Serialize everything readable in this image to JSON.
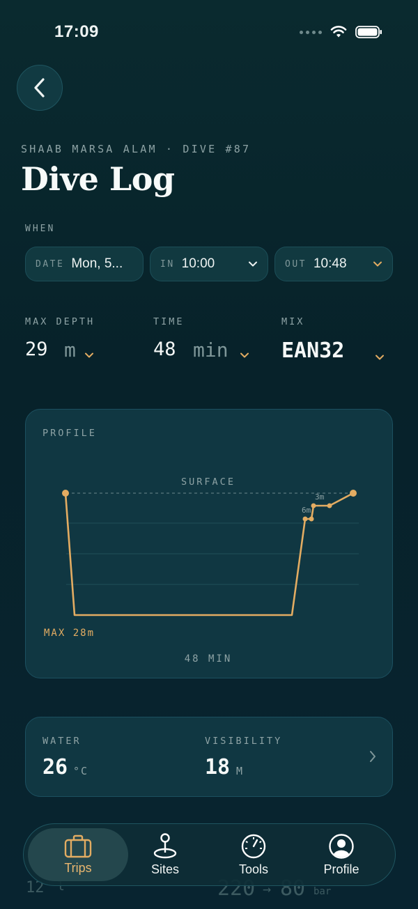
{
  "status_bar": {
    "time": "17:09"
  },
  "header": {
    "eyebrow": "SHAAB MARSA ALAM · DIVE #87",
    "title": "Dive Log"
  },
  "when": {
    "label": "WHEN",
    "date": {
      "label": "DATE",
      "value": "Mon, 5..."
    },
    "in": {
      "label": "IN",
      "value": "10:00"
    },
    "out": {
      "label": "OUT",
      "value": "10:48"
    }
  },
  "stats": {
    "max_depth": {
      "label": "MAX DEPTH",
      "value": "29",
      "unit": "m"
    },
    "time": {
      "label": "TIME",
      "value": "48",
      "unit": "min"
    },
    "mix": {
      "label": "MIX",
      "value": "EAN32"
    }
  },
  "profile": {
    "label": "PROFILE",
    "surface_label": "SURFACE",
    "max_label": "MAX 28m",
    "duration_label": "48 MIN",
    "stop_labels": [
      "6m",
      "3m"
    ],
    "color": "#e3ac62"
  },
  "conditions": {
    "water": {
      "label": "WATER",
      "value": "26",
      "unit": "°C"
    },
    "visibility": {
      "label": "VISIBILITY",
      "value": "18",
      "unit": "M"
    }
  },
  "behind_row": {
    "left": "12",
    "left_unit": "l",
    "pressure_start": "220",
    "pressure_end": "80",
    "pressure_unit": "bar"
  },
  "tabbar": {
    "active": "Trips",
    "tabs": [
      {
        "label": "Trips",
        "icon": "briefcase-icon"
      },
      {
        "label": "Sites",
        "icon": "map-pin-icon"
      },
      {
        "label": "Tools",
        "icon": "gauge-icon"
      },
      {
        "label": "Profile",
        "icon": "user-circle-icon"
      }
    ]
  },
  "colors": {
    "accent": "#e3ac62",
    "background": "#082226",
    "card": "#103742"
  }
}
